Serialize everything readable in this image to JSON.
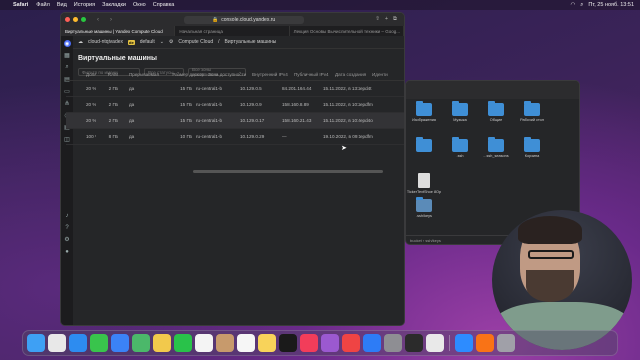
{
  "menubar": {
    "apple": "",
    "items": [
      "Safari",
      "Файл",
      "Вид",
      "История",
      "Закладки",
      "Окно",
      "Справка"
    ],
    "clock": "Пт, 25 нояб.  13:51"
  },
  "browser": {
    "url": "console.cloud.yandex.ru",
    "tabs": [
      "Виртуальные машины | Yandex Compute Cloud",
      "Начальная страница",
      "Лекция Основы Вычислительной техники – Goog..."
    ]
  },
  "cloud": {
    "cloud_name": "cloud-ntqivadex",
    "folder_badge": "de",
    "folder_name": "default",
    "service": "Compute Cloud",
    "breadcrumb_page": "Виртуальные машины",
    "page_title": "Виртуальные машины",
    "filter_name_placeholder": "Фильтр по имени",
    "filter_status": "Все статусы",
    "filter_zone": "Все зоны доступности"
  },
  "table": {
    "headers": [
      "Доля vCPU",
      "RAM",
      "Прерываемая",
      "Размер дисков",
      "Зона доступности",
      "Внутренний IPv4",
      "Публичный IPv4",
      "Дата создания",
      "Иденти"
    ],
    "rows": [
      [
        "20 %",
        "2 ГБ",
        "да",
        "15 ГБ",
        "ru-central1-b",
        "10.129.0.5",
        "84.201.164.44",
        "15.11.2022, в 13:20",
        "epd4t"
      ],
      [
        "20 %",
        "2 ГБ",
        "да",
        "15 ГБ",
        "ru-central1-b",
        "10.129.0.9",
        "158.160.8.89",
        "15.11.2022, в 10:27",
        "epdfm"
      ],
      [
        "20 %",
        "2 ГБ",
        "да",
        "15 ГБ",
        "ru-central1-b",
        "10.129.0.17",
        "158.160.21.43",
        "15.11.2022, в 10:43",
        "epd4o"
      ],
      [
        "100 %",
        "8 ГБ",
        "да",
        "10 ГБ",
        "ru-central1-b",
        "10.129.0.29",
        "—",
        "19.10.2022, в 09:18",
        "epdfm"
      ]
    ]
  },
  "finder": {
    "items": [
      "Изображения",
      "Музыка",
      "Общие",
      "Рабочий стол",
      "",
      "",
      "",
      ".ssh",
      "...ssh_seasons",
      "Корзина",
      "TickerTextShoe 8Op",
      "",
      "",
      ".ssh/keys"
    ],
    "path": "bucket  ›  ssh/keys"
  },
  "dock": {
    "icons": [
      "finder-icon",
      "launchpad-icon",
      "safari-icon",
      "messages-icon",
      "mail-icon",
      "maps-icon",
      "photos-icon",
      "facetime-icon",
      "calendar-icon",
      "contacts-icon",
      "reminders-icon",
      "notes-icon",
      "tv-icon",
      "music-icon",
      "podcasts-icon",
      "news-icon",
      "appstore-icon",
      "system-preferences-icon",
      "terminal-icon",
      "chrome-icon",
      "zoom-icon",
      "tool-icon",
      "trash-icon"
    ],
    "colors": [
      "#3ea0f4",
      "#e8e8e8",
      "#2d8cf0",
      "#39c44c",
      "#3b82f6",
      "#4bb86a",
      "#f2c94c",
      "#29c24a",
      "#f4f4f4",
      "#c79a6c",
      "#f6f6f6",
      "#f8d35a",
      "#1a1a1a",
      "#f23d5a",
      "#9b59d0",
      "#ef4444",
      "#2d7cf6",
      "#8e8e93",
      "#2b2b2b",
      "#e9e9e9",
      "#2d8cff",
      "#f97316",
      "#a0a0a8"
    ]
  }
}
